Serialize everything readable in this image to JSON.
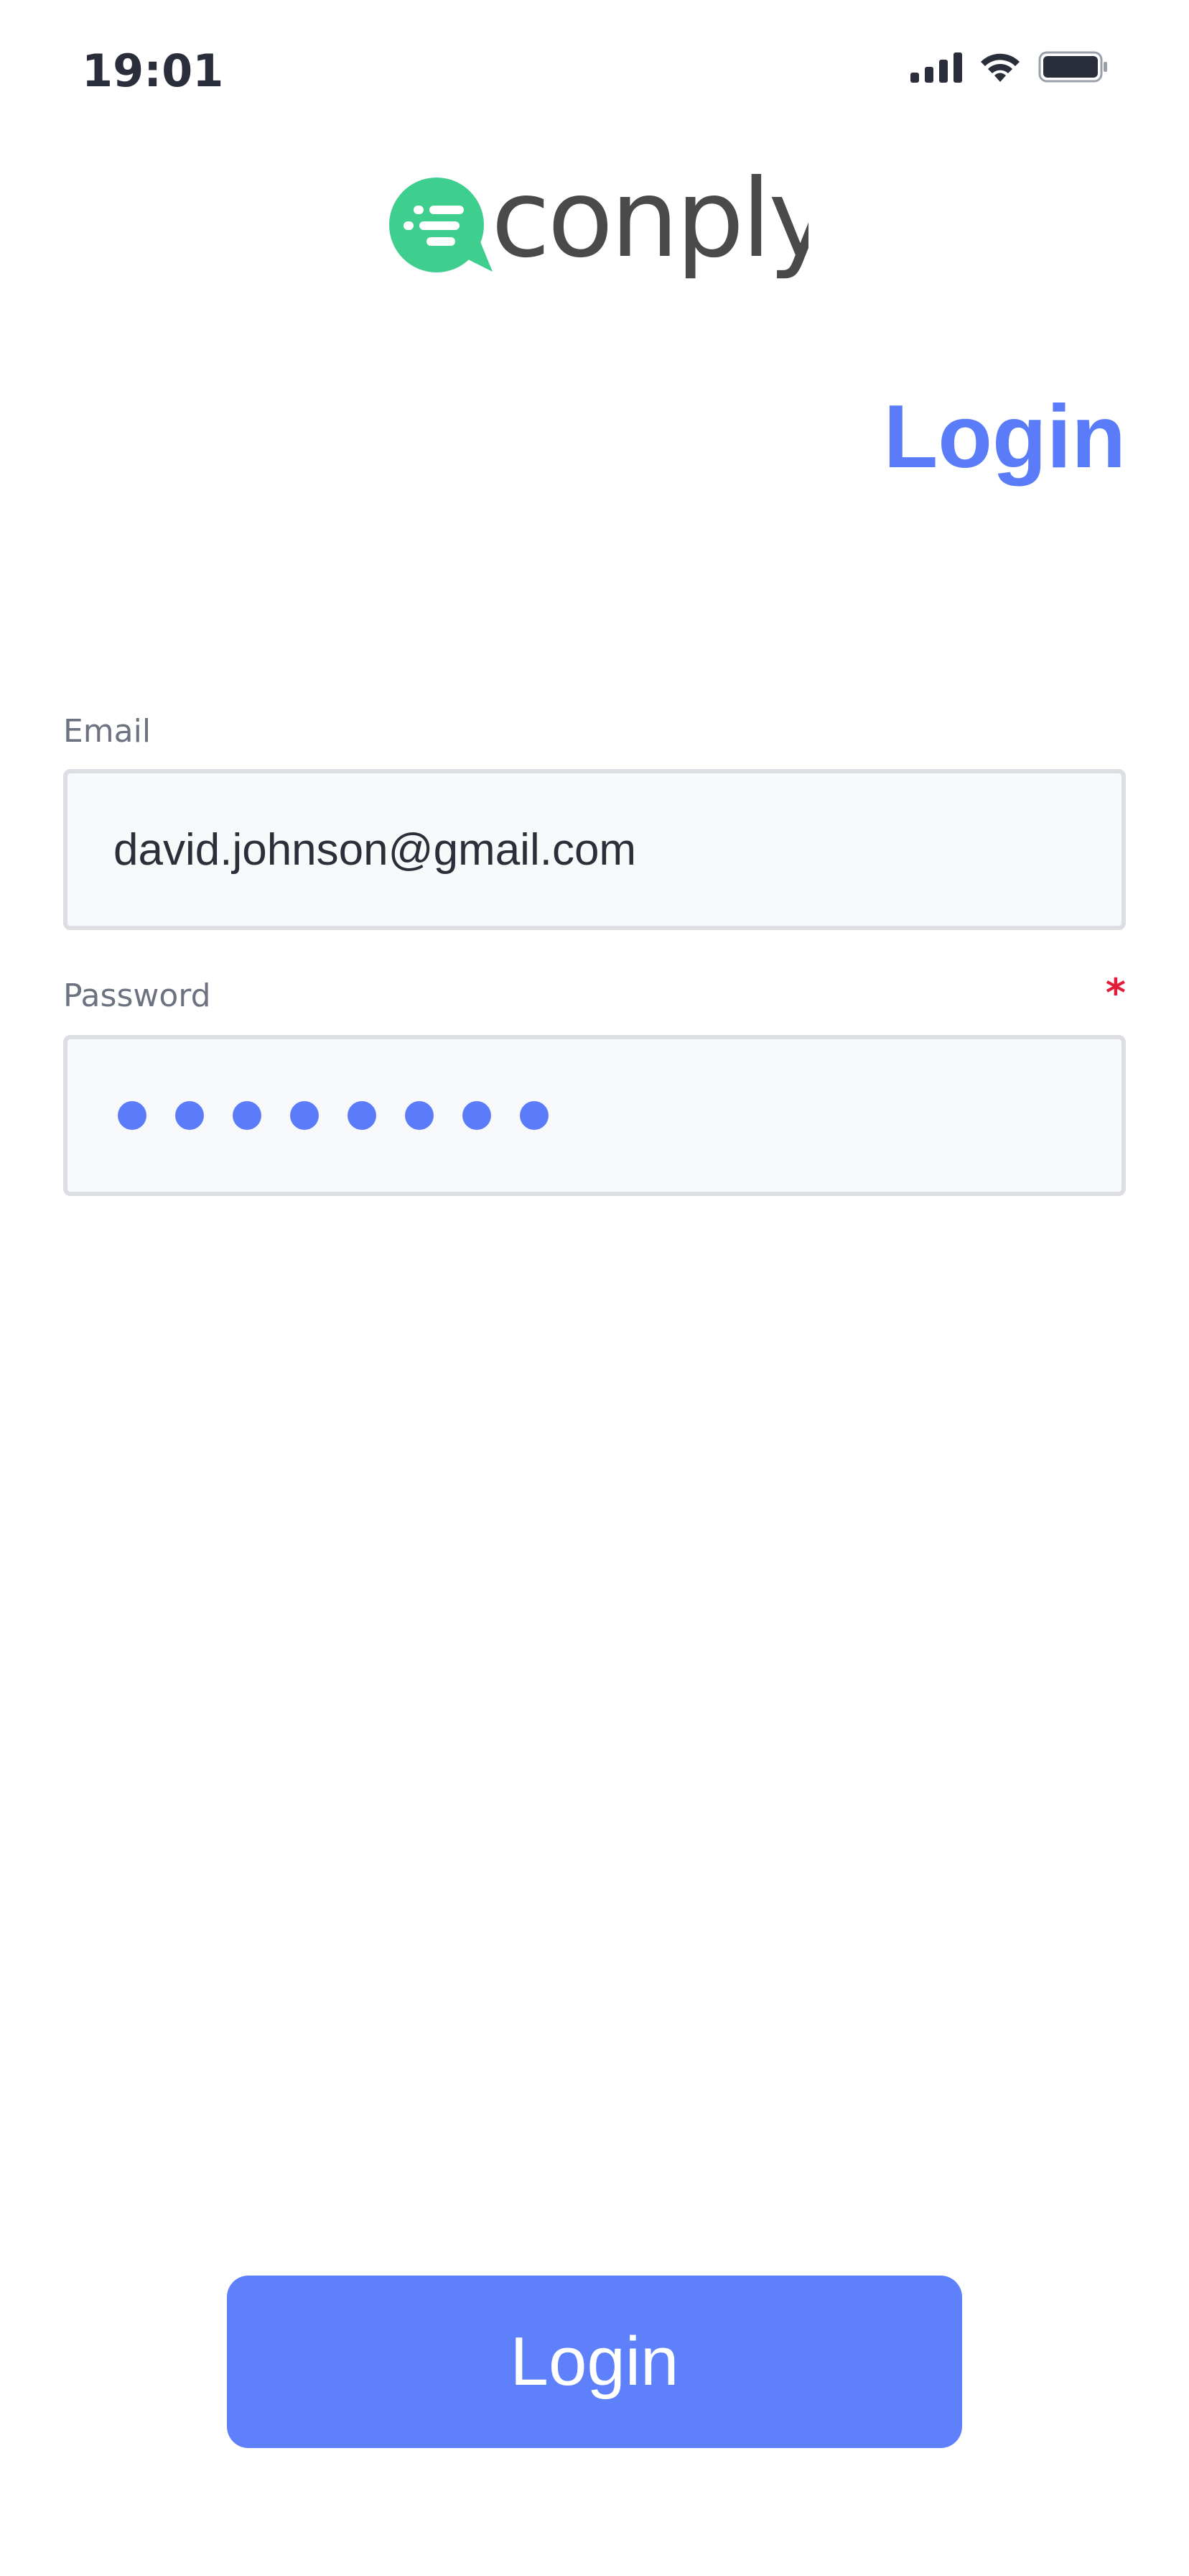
{
  "status_bar": {
    "time": "19:01",
    "signal_icon": "cellular-signal-icon",
    "wifi_icon": "wifi-icon",
    "battery_icon": "battery-icon"
  },
  "brand": {
    "logo_icon": "chat-bubble-logo-icon",
    "wordmark": "conply",
    "logo_color": "#3ecf8e",
    "wordmark_color": "#4a4a4a"
  },
  "page": {
    "title": "Login"
  },
  "form": {
    "email": {
      "label": "Email",
      "value": "david.johnson@gmail.com"
    },
    "password": {
      "label": "Password",
      "required_mark": "*",
      "masked_length": 8
    }
  },
  "actions": {
    "login_label": "Login"
  },
  "colors": {
    "accent": "#5b7cf8",
    "required": "#e21d3c"
  }
}
